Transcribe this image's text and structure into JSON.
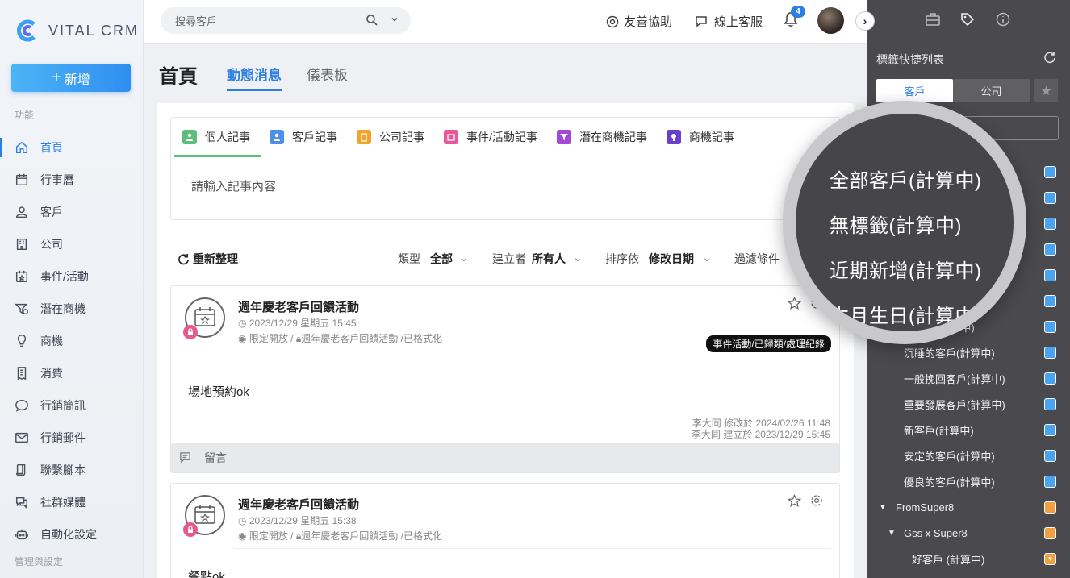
{
  "app": {
    "brand": "VITAL CRM",
    "new_label": "新增"
  },
  "sidebar": {
    "section_functions": "功能",
    "section_admin": "管理與設定",
    "items": [
      {
        "label": "首頁",
        "icon": "home-icon",
        "active": true
      },
      {
        "label": "行事曆",
        "icon": "calendar-icon"
      },
      {
        "label": "客戶",
        "icon": "customer-icon"
      },
      {
        "label": "公司",
        "icon": "building-icon"
      },
      {
        "label": "事件/活動",
        "icon": "event-icon"
      },
      {
        "label": "潛在商機",
        "icon": "funnel-icon"
      },
      {
        "label": "商機",
        "icon": "bulb-icon"
      },
      {
        "label": "消費",
        "icon": "receipt-icon"
      },
      {
        "label": "行銷簡訊",
        "icon": "sms-icon"
      },
      {
        "label": "行銷郵件",
        "icon": "mail-icon"
      },
      {
        "label": "聯繫腳本",
        "icon": "script-icon"
      },
      {
        "label": "社群媒體",
        "icon": "chat-icon"
      },
      {
        "label": "自動化設定",
        "icon": "robot-icon"
      }
    ]
  },
  "topbar": {
    "search_placeholder": "搜尋客戶",
    "help_label": "友善協助",
    "support_label": "線上客服",
    "notification_count": "4"
  },
  "page": {
    "title": "首頁",
    "tabs": [
      {
        "label": "動態消息",
        "active": true
      },
      {
        "label": "儀表板"
      }
    ]
  },
  "note_tabs": [
    {
      "label": "個人記事",
      "color": "#5cbf7a",
      "active": true
    },
    {
      "label": "客戶記事",
      "color": "#4f8fe8"
    },
    {
      "label": "公司記事",
      "color": "#f0a52a"
    },
    {
      "label": "事件/活動記事",
      "color": "#e8579a"
    },
    {
      "label": "潛在商機記事",
      "color": "#a349d6"
    },
    {
      "label": "商機記事",
      "color": "#6a3fc9"
    }
  ],
  "editor": {
    "placeholder": "請輸入記事內容"
  },
  "filters": {
    "refresh_label": "重新整理",
    "type_label": "類型",
    "type_value": "全部",
    "creator_label": "建立者",
    "creator_value": "所有人",
    "sort_label": "排序依",
    "sort_value": "修改日期",
    "filter_label": "過濾條件"
  },
  "posts": [
    {
      "title": "週年慶老客戶回饋活動",
      "date": "2023/12/29 星期五 15:45",
      "visibility": "限定開放",
      "event": "週年慶老客戶回饋活動",
      "status": "已格式化",
      "tag": "事件活動/已歸類/處理紀錄",
      "body": "場地預約ok",
      "modified": "李大同 修改於 2024/02/26 11:48",
      "created": "李大同 建立於 2023/12/29 15:45",
      "comment_label": "留言"
    },
    {
      "title": "週年慶老客戶回饋活動",
      "date": "2023/12/29 星期五 15:38",
      "visibility": "限定開放",
      "event": "週年慶老客戶回饋活動",
      "status": "已格式化",
      "body": "餐點ok"
    }
  ],
  "right_panel": {
    "title": "標籤快捷列表",
    "seg_customer": "客戶",
    "seg_company": "公司",
    "tags": [
      {
        "label": "沉睡的客戶(計算中)",
        "color": "#4aa3f0"
      },
      {
        "label": "一般挽回客戶(計算中)",
        "color": "#4aa3f0"
      },
      {
        "label": "重要發展客戶(計算中)",
        "color": "#4aa3f0"
      },
      {
        "label": "新客戶(計算中)",
        "color": "#4aa3f0"
      },
      {
        "label": "安定的客戶(計算中)",
        "color": "#4aa3f0"
      },
      {
        "label": "優良的客戶(計算中)",
        "color": "#4aa3f0"
      }
    ],
    "partial_tag": "(計算中)",
    "group1": "FromSuper8",
    "group2": "Gss x Super8",
    "group2_item": "好客戶 (計算中)",
    "orange": "#f0a040"
  },
  "popup": {
    "items": [
      "全部客戶(計算中)",
      "無標籤(計算中)",
      "近期新增(計算中)",
      "本月生日(計算中)"
    ]
  }
}
